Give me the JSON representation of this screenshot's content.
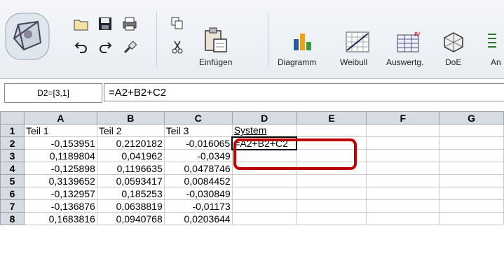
{
  "toolbar": {
    "paste_label": "Einfügen",
    "diagram_label": "Diagramm",
    "weibull_label": "Weibull",
    "auswertung_label": "Auswertg.",
    "doe_label": "DoE",
    "more_label": "An"
  },
  "formula_bar": {
    "cell_ref": "D2=[3,1]",
    "formula": "=A2+B2+C2"
  },
  "sheet": {
    "columns": [
      "A",
      "B",
      "C",
      "D",
      "E",
      "F",
      "G"
    ],
    "rows": [
      {
        "num": "1",
        "cells": [
          "Teil 1",
          "Teil 2",
          "Teil 3",
          "System",
          "",
          "",
          ""
        ]
      },
      {
        "num": "2",
        "cells": [
          "-0,153951",
          "0,2120182",
          "-0,016065",
          "=A2+B2+C2",
          "",
          "",
          ""
        ]
      },
      {
        "num": "3",
        "cells": [
          "0,1189804",
          "0,041962",
          "-0,0349",
          "",
          "",
          "",
          ""
        ]
      },
      {
        "num": "4",
        "cells": [
          "-0,125898",
          "0,1196635",
          "0,0478746",
          "",
          "",
          "",
          ""
        ]
      },
      {
        "num": "5",
        "cells": [
          "0,3139652",
          "0,0593417",
          "0,0084452",
          "",
          "",
          "",
          ""
        ]
      },
      {
        "num": "6",
        "cells": [
          "-0,132957",
          "0,185253",
          "-0,030849",
          "",
          "",
          "",
          ""
        ]
      },
      {
        "num": "7",
        "cells": [
          "-0,136876",
          "0,0638819",
          "-0,01173",
          "",
          "",
          "",
          ""
        ]
      },
      {
        "num": "8",
        "cells": [
          "0,1683816",
          "0,0940768",
          "0,0203644",
          "",
          "",
          "",
          ""
        ]
      }
    ]
  }
}
